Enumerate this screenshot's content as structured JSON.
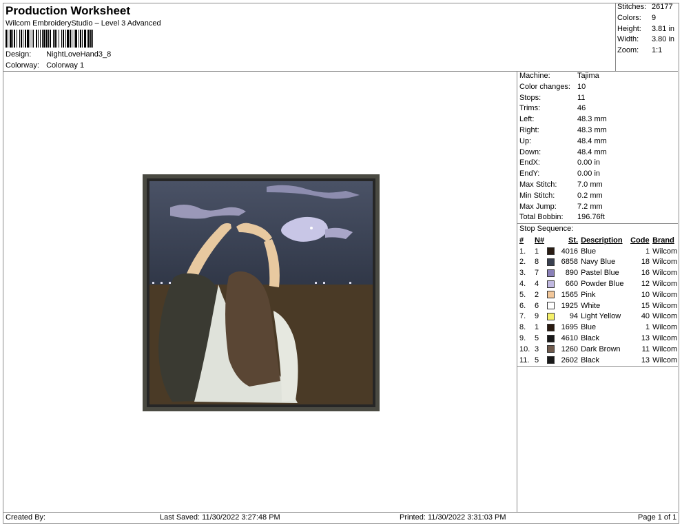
{
  "header": {
    "title": "Production Worksheet",
    "subtitle": "Wilcom EmbroideryStudio – Level 3 Advanced",
    "design_label": "Design:",
    "design_value": "NightLoveHand3_8",
    "colorway_label": "Colorway:",
    "colorway_value": "Colorway 1"
  },
  "stats": [
    {
      "label": "Stitches:",
      "value": "26177"
    },
    {
      "label": "Colors:",
      "value": "9"
    },
    {
      "label": "Height:",
      "value": "3.81 in"
    },
    {
      "label": "Width:",
      "value": "3.80 in"
    },
    {
      "label": "Zoom:",
      "value": "1:1"
    }
  ],
  "info": [
    {
      "label": "Machine:",
      "value": "Tajima"
    },
    {
      "label": "Color changes:",
      "value": "10"
    },
    {
      "label": "Stops:",
      "value": "11"
    },
    {
      "label": "Trims:",
      "value": "46"
    },
    {
      "label": "Left:",
      "value": "48.3 mm"
    },
    {
      "label": "Right:",
      "value": "48.3 mm"
    },
    {
      "label": "Up:",
      "value": "48.4 mm"
    },
    {
      "label": "Down:",
      "value": "48.4 mm"
    },
    {
      "label": "EndX:",
      "value": "0.00 in"
    },
    {
      "label": "EndY:",
      "value": "0.00 in"
    },
    {
      "label": "Max Stitch:",
      "value": "7.0 mm"
    },
    {
      "label": "Min Stitch:",
      "value": "0.2 mm"
    },
    {
      "label": "Max Jump:",
      "value": "7.2 mm"
    },
    {
      "label": "Total Bobbin:",
      "value": "196.76ft"
    }
  ],
  "stop_sequence": {
    "title": "Stop Sequence:",
    "headers": [
      "#",
      "N#",
      "St.",
      "Description",
      "Code",
      "Brand"
    ],
    "rows": [
      {
        "num": "1.",
        "n": "1",
        "color": "#2a1d14",
        "st": "4016",
        "desc": "Blue",
        "code": "1",
        "brand": "Wilcom"
      },
      {
        "num": "2.",
        "n": "8",
        "color": "#3a4050",
        "st": "6858",
        "desc": "Navy Blue",
        "code": "18",
        "brand": "Wilcom"
      },
      {
        "num": "3.",
        "n": "7",
        "color": "#8a80b8",
        "st": "890",
        "desc": "Pastel Blue",
        "code": "16",
        "brand": "Wilcom"
      },
      {
        "num": "4.",
        "n": "4",
        "color": "#c0b8e0",
        "st": "660",
        "desc": "Powder Blue",
        "code": "12",
        "brand": "Wilcom"
      },
      {
        "num": "5.",
        "n": "2",
        "color": "#f2c79a",
        "st": "1565",
        "desc": "Pink",
        "code": "10",
        "brand": "Wilcom"
      },
      {
        "num": "6.",
        "n": "6",
        "color": "#ffffff",
        "st": "1925",
        "desc": "White",
        "code": "15",
        "brand": "Wilcom"
      },
      {
        "num": "7.",
        "n": "9",
        "color": "#f5f06a",
        "st": "94",
        "desc": "Light Yellow",
        "code": "40",
        "brand": "Wilcom"
      },
      {
        "num": "8.",
        "n": "1",
        "color": "#2a1a10",
        "st": "1695",
        "desc": "Blue",
        "code": "1",
        "brand": "Wilcom"
      },
      {
        "num": "9.",
        "n": "5",
        "color": "#1a1a1a",
        "st": "4610",
        "desc": "Black",
        "code": "13",
        "brand": "Wilcom"
      },
      {
        "num": "10.",
        "n": "3",
        "color": "#6f5a4c",
        "st": "1260",
        "desc": "Dark Brown",
        "code": "11",
        "brand": "Wilcom"
      },
      {
        "num": "11.",
        "n": "5",
        "color": "#1a1a1a",
        "st": "2602",
        "desc": "Black",
        "code": "13",
        "brand": "Wilcom"
      }
    ]
  },
  "footer": {
    "created": "Created By:",
    "saved": "Last Saved: 11/30/2022 3:27:48 PM",
    "printed": "Printed: 11/30/2022 3:31:03 PM",
    "page": "Page 1 of 1"
  }
}
